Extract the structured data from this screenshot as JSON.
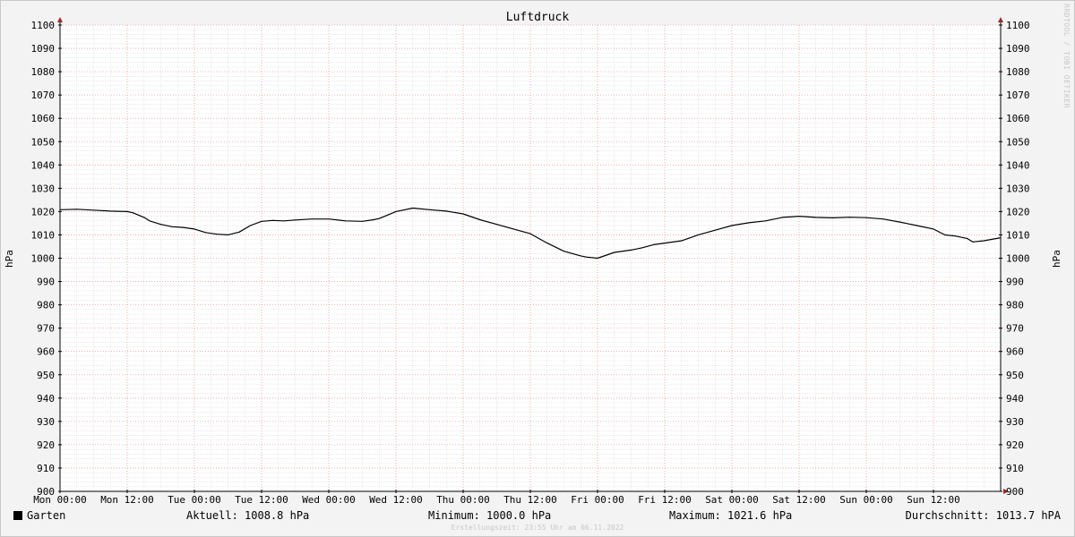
{
  "chart_data": {
    "type": "line",
    "title": "Luftdruck",
    "ylabel": "hPa",
    "ylabel_right": "hPa",
    "ylim": [
      900,
      1100
    ],
    "y_step": 10,
    "y_ticks": [
      900,
      910,
      920,
      930,
      940,
      950,
      960,
      970,
      980,
      990,
      1000,
      1010,
      1020,
      1030,
      1040,
      1050,
      1060,
      1070,
      1080,
      1090,
      1100
    ],
    "x_ticks": [
      "Mon 00:00",
      "Mon 12:00",
      "Tue 00:00",
      "Tue 12:00",
      "Wed 00:00",
      "Wed 12:00",
      "Thu 00:00",
      "Thu 12:00",
      "Fri 00:00",
      "Fri 12:00",
      "Sat 00:00",
      "Sat 12:00",
      "Sun 00:00",
      "Sun 12:00"
    ],
    "x_unit": "hours since Mon 00:00",
    "xlim": [
      0,
      168
    ],
    "grid": true,
    "series": [
      {
        "name": "Garten",
        "color": "#000000",
        "x": [
          0,
          3,
          6,
          9,
          12,
          13,
          15,
          16,
          18,
          20,
          22,
          24,
          26,
          28,
          30,
          32,
          34,
          36,
          38,
          40,
          42,
          45,
          48,
          51,
          54,
          56,
          57,
          60,
          63,
          66,
          69,
          72,
          75,
          78,
          81,
          84,
          87,
          90,
          93,
          94,
          96,
          99,
          102,
          104,
          106,
          108,
          111,
          114,
          117,
          120,
          123,
          126,
          129,
          132,
          135,
          138,
          141,
          144,
          147,
          150,
          153,
          156,
          158,
          160,
          162,
          163,
          165,
          168
        ],
        "y": [
          1020.8,
          1021.0,
          1020.6,
          1020.2,
          1020.0,
          1019.5,
          1017.5,
          1016.0,
          1014.5,
          1013.5,
          1013.2,
          1012.5,
          1011.0,
          1010.3,
          1010.0,
          1011.2,
          1014.0,
          1015.8,
          1016.2,
          1016.0,
          1016.4,
          1016.8,
          1016.8,
          1016.0,
          1015.8,
          1016.5,
          1017.0,
          1020.0,
          1021.5,
          1020.8,
          1020.2,
          1019.0,
          1016.5,
          1014.5,
          1012.5,
          1010.5,
          1006.5,
          1003.0,
          1001.0,
          1000.5,
          1000.0,
          1002.5,
          1003.5,
          1004.5,
          1005.8,
          1006.5,
          1007.5,
          1010.0,
          1012.0,
          1014.0,
          1015.2,
          1016.0,
          1017.5,
          1018.0,
          1017.5,
          1017.3,
          1017.6,
          1017.4,
          1016.8,
          1015.5,
          1014.0,
          1012.5,
          1010.0,
          1009.5,
          1008.5,
          1007.0,
          1007.5,
          1008.8
        ]
      }
    ]
  },
  "legend": {
    "series_label": "Garten",
    "current": "Aktuell: 1008.8 hPa",
    "minimum": "Minimum: 1000.0 hPa",
    "maximum": "Maximum: 1021.6 hPa",
    "average": "Durchschnitt: 1013.7 hPA"
  },
  "footer": "Erstellungszeit: 23:55 Uhr am 06.11.2022",
  "watermark": "RRDTOOL / TOBI OETIKER"
}
